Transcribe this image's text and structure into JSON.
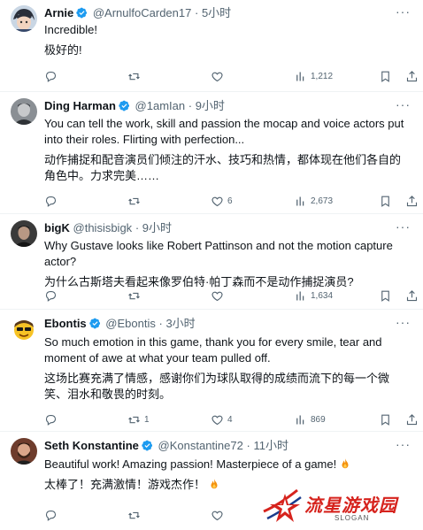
{
  "tweets": [
    {
      "name": "Arnie",
      "handle": "@ArnulfoCarden17",
      "separator": "·",
      "time": "5小时",
      "body_en": "Incredible!",
      "body_zh": "极好的!",
      "replies": "",
      "retweets": "",
      "likes": "",
      "views": "1,212",
      "avatar_icon": "anime-avatar"
    },
    {
      "name": "Ding Harman",
      "handle": "@1amIan",
      "separator": "·",
      "time": "9小时",
      "body_en": "You can tell the work, skill and passion the mocap and voice actors put into their roles. Flirting with perfection...",
      "body_zh": "动作捕捉和配音演员们倾注的汗水、技巧和热情，都体现在他们各自的角色中。力求完美……",
      "replies": "",
      "retweets": "",
      "likes": "6",
      "views": "2,673",
      "avatar_icon": "grey-portrait-avatar"
    },
    {
      "name": "bigK",
      "handle": "@thisisbigk",
      "separator": "·",
      "time": "9小时",
      "body_en": "Why Gustave looks like Robert Pattinson and not the motion capture actor?",
      "body_zh": "为什么古斯塔夫看起来像罗伯特·帕丁森而不是动作捕捉演员?",
      "replies": "",
      "retweets": "",
      "likes": "",
      "views": "1,634",
      "avatar_icon": "dark-portrait-avatar"
    },
    {
      "name": "Ebontis",
      "handle": "@Ebontis",
      "separator": "·",
      "time": "3小时",
      "body_en": "So much emotion in this game, thank you for every smile, tear and moment of awe at what your team pulled off.",
      "body_zh": "这场比赛充满了情感，感谢你们为球队取得的成绩而流下的每一个微笑、泪水和敬畏的时刻。",
      "replies": "",
      "retweets": "1",
      "likes": "4",
      "views": "869",
      "avatar_icon": "emoji-avatar"
    },
    {
      "name": "Seth Konstantine",
      "handle": "@Konstantine72",
      "separator": "·",
      "time": "11小时",
      "body_en": "Beautiful work! Amazing passion! Masterpiece of a game!",
      "body_zh": "太棒了！充满激情！游戏杰作！",
      "replies": "",
      "retweets": "",
      "likes": "",
      "views": "",
      "avatar_icon": "bearded-man-avatar"
    }
  ],
  "watermark": {
    "title": "流星游戏园",
    "slogan": "SLOGAN"
  },
  "colors": {
    "verified": "#1d9bf0",
    "secondary_text": "#536471",
    "divider": "#eff3f4",
    "watermark_red": "#d6231d"
  }
}
